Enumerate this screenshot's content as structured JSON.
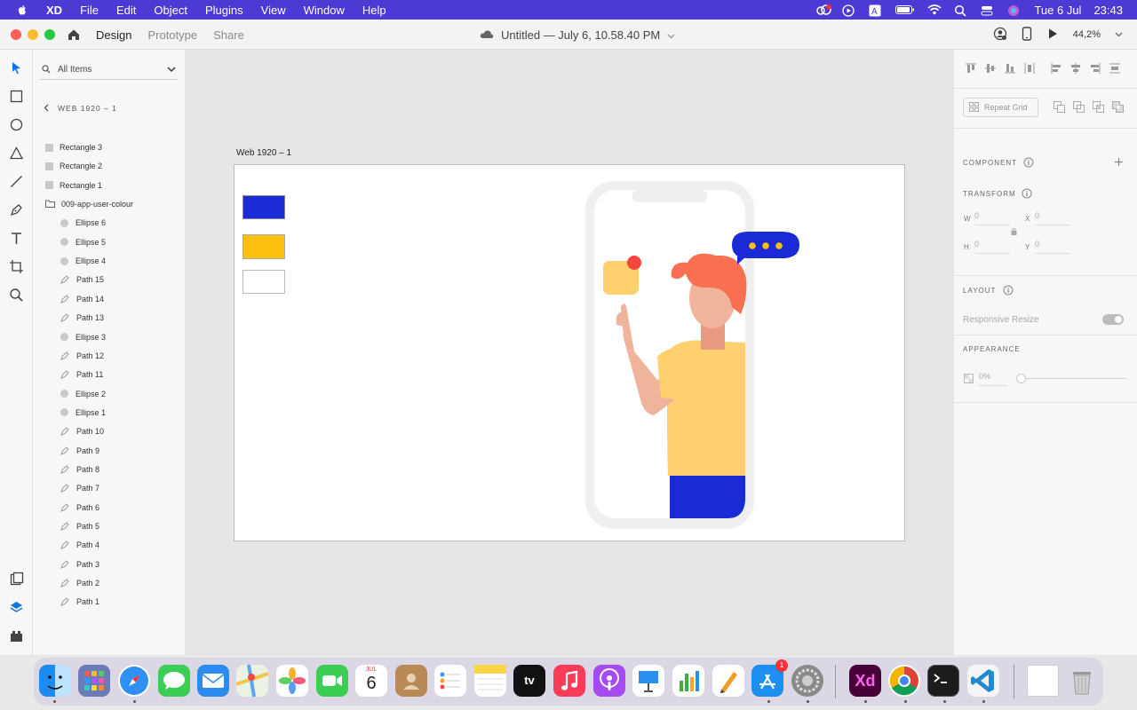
{
  "menubar": {
    "app": "XD",
    "items": [
      "File",
      "Edit",
      "Object",
      "Plugins",
      "View",
      "Window",
      "Help"
    ],
    "date": "Tue 6 Jul",
    "time": "23:43"
  },
  "titlebar": {
    "tabs": [
      "Design",
      "Prototype",
      "Share"
    ],
    "doc_title": "Untitled — July 6, 10.58.40 PM",
    "zoom": "44,2%"
  },
  "layers": {
    "search_placeholder": "All Items",
    "breadcrumb": "WEB 1920 – 1",
    "items": [
      {
        "label": "Rectangle 3",
        "kind": "rect",
        "indent": 0
      },
      {
        "label": "Rectangle 2",
        "kind": "rect",
        "indent": 0
      },
      {
        "label": "Rectangle 1",
        "kind": "rect",
        "indent": 0
      },
      {
        "label": "009-app-user-colour",
        "kind": "group",
        "indent": 0
      },
      {
        "label": "Ellipse 6",
        "kind": "ellipse",
        "indent": 1
      },
      {
        "label": "Ellipse 5",
        "kind": "ellipse",
        "indent": 1
      },
      {
        "label": "Ellipse 4",
        "kind": "ellipse",
        "indent": 1
      },
      {
        "label": "Path 15",
        "kind": "path",
        "indent": 1
      },
      {
        "label": "Path 14",
        "kind": "path",
        "indent": 1
      },
      {
        "label": "Path 13",
        "kind": "path",
        "indent": 1
      },
      {
        "label": "Ellipse 3",
        "kind": "ellipse",
        "indent": 1
      },
      {
        "label": "Path 12",
        "kind": "path",
        "indent": 1
      },
      {
        "label": "Path 11",
        "kind": "path",
        "indent": 1
      },
      {
        "label": "Ellipse 2",
        "kind": "ellipse",
        "indent": 1
      },
      {
        "label": "Ellipse 1",
        "kind": "ellipse",
        "indent": 1
      },
      {
        "label": "Path 10",
        "kind": "path",
        "indent": 1
      },
      {
        "label": "Path 9",
        "kind": "path",
        "indent": 1
      },
      {
        "label": "Path 8",
        "kind": "path",
        "indent": 1
      },
      {
        "label": "Path 7",
        "kind": "path",
        "indent": 1
      },
      {
        "label": "Path 6",
        "kind": "path",
        "indent": 1
      },
      {
        "label": "Path 5",
        "kind": "path",
        "indent": 1
      },
      {
        "label": "Path 4",
        "kind": "path",
        "indent": 1
      },
      {
        "label": "Path 3",
        "kind": "path",
        "indent": 1
      },
      {
        "label": "Path 2",
        "kind": "path",
        "indent": 1
      },
      {
        "label": "Path 1",
        "kind": "path",
        "indent": 1
      }
    ]
  },
  "canvas": {
    "artboard_label": "Web 1920 – 1",
    "swatch_colors": [
      "#1a2bd6",
      "#fdbf10",
      "#ffffff"
    ]
  },
  "props": {
    "repeat_grid": "Repeat Grid",
    "component": "COMPONENT",
    "transform": "TRANSFORM",
    "w_label": "W",
    "w_value": "0",
    "x_label": "X",
    "x_value": "0",
    "h_label": "H",
    "h_value": "0",
    "y_label": "Y",
    "y_value": "0",
    "layout": "LAYOUT",
    "responsive_resize": "Responsive Resize",
    "appearance": "APPEARANCE",
    "opacity": "0%"
  },
  "dock": {
    "calendar_month": "JUL",
    "calendar_day": "6",
    "appstore_badge": "1",
    "xd_label": "Xd",
    "tv_label": "tv"
  },
  "colors": {
    "accent_blue": "#1a2bd6",
    "accent_yellow": "#fdbf10",
    "menubar": "#4b3ad4"
  }
}
